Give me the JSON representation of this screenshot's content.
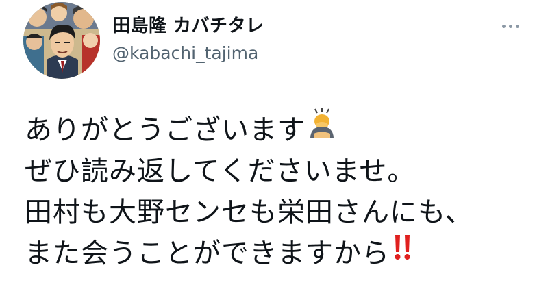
{
  "author": {
    "display_name": "田島隆 カバチタレ",
    "handle": "@kabachi_tajima",
    "avatar_icon": "manga-characters-avatar"
  },
  "actions": {
    "more_icon": "more-dots-icon"
  },
  "tweet": {
    "lines": [
      "ありがとうございます",
      "ぜひ読み返してくださいませ。",
      "田村も大野センセも栄田さんにも、",
      "また会うことができますから"
    ],
    "emojis": {
      "line1": "bowing-person-emoji",
      "line4": "double-exclamation-emoji"
    }
  },
  "colors": {
    "text": "#0f1419",
    "secondary": "#536471",
    "exclamation": "#e0201f"
  }
}
